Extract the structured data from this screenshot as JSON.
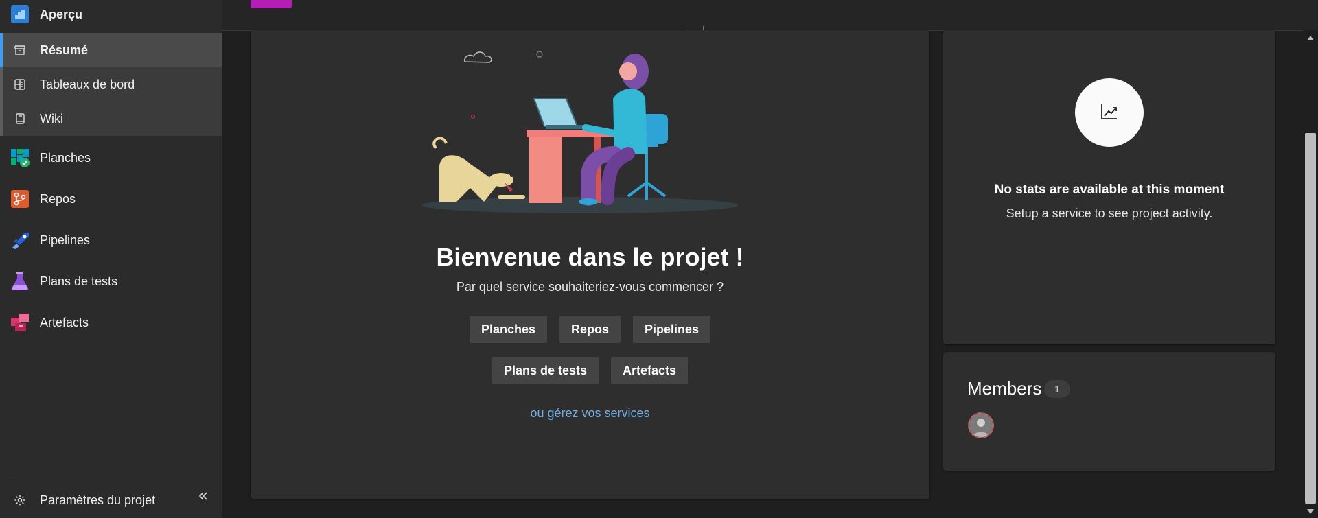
{
  "sidebar": {
    "overview": {
      "label": "Aperçu",
      "icon": "overview-icon"
    },
    "sub_items": [
      {
        "label": "Résumé",
        "icon": "summary-icon",
        "selected": true
      },
      {
        "label": "Tableaux de bord",
        "icon": "dashboards-icon"
      },
      {
        "label": "Wiki",
        "icon": "wiki-icon"
      }
    ],
    "items": [
      {
        "label": "Planches",
        "icon": "boards-icon",
        "color": "#009ccc"
      },
      {
        "label": "Repos",
        "icon": "repos-icon",
        "color": "#e05a2b"
      },
      {
        "label": "Pipelines",
        "icon": "pipelines-icon",
        "color": "#2560e0"
      },
      {
        "label": "Plans de tests",
        "icon": "test-plans-icon",
        "color": "#8c4fd8"
      },
      {
        "label": "Artefacts",
        "icon": "artifacts-icon",
        "color": "#d6386c"
      }
    ],
    "settings_label": "Paramètres du projet",
    "collapse_icon": "double-chevron-left-icon"
  },
  "welcome": {
    "title": "Bienvenue dans le projet !",
    "subtitle": "Par quel service souhaiteriez-vous commencer ?",
    "buttons_row1": [
      "Planches",
      "Repos",
      "Pipelines"
    ],
    "buttons_row2": [
      "Plans de tests",
      "Artefacts"
    ],
    "manage_link": "ou gérez vos services"
  },
  "stats": {
    "icon": "trend-chart-icon",
    "title": "No stats are available at this moment",
    "subtitle": "Setup a service to see project activity."
  },
  "members": {
    "title": "Members",
    "count": "1"
  },
  "colors": {
    "accent": "#3b9cf5",
    "link": "#71afe5",
    "project_chip": "#b41eb4"
  }
}
